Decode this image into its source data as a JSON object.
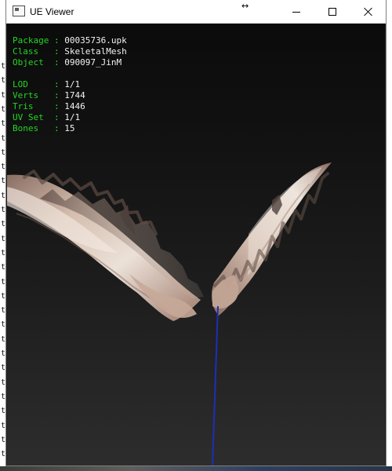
{
  "window": {
    "title": "UE Viewer",
    "buttons": {
      "minimize": "minimize",
      "maximize": "maximize",
      "close": "close"
    }
  },
  "viewer": {
    "info": [
      {
        "label": "Package",
        "separator": ":",
        "value": "00035736.upk"
      },
      {
        "label": "Class  ",
        "separator": ":",
        "value": "SkeletalMesh"
      },
      {
        "label": "Object ",
        "separator": ":",
        "value": "090097_JinM"
      },
      {
        "label": "",
        "separator": "",
        "value": ""
      },
      {
        "label": "LOD    ",
        "separator": ":",
        "value": "1/1"
      },
      {
        "label": "Verts  ",
        "separator": ":",
        "value": "1744"
      },
      {
        "label": "Tris   ",
        "separator": ":",
        "value": "1446"
      },
      {
        "label": "UV Set ",
        "separator": ":",
        "value": "1/1"
      },
      {
        "label": "Bones  ",
        "separator": ":",
        "value": "15"
      }
    ]
  },
  "background_console": {
    "line_char": "t",
    "rows": 28
  },
  "icons": {
    "app": "app-window-icon",
    "resize": "horizontal-resize-icon",
    "minimize": "minimize-icon",
    "maximize": "maximize-icon",
    "close": "close-icon"
  },
  "colors": {
    "titlebar": "#ffffff",
    "viewport_top": "#0b0b0b",
    "viewport_bottom": "#2d2d2d",
    "info_label": "#23d623",
    "info_value": "#f2f2f2",
    "wing_light": "#e6d4c8",
    "wing_mid": "#bfa394",
    "wing_dark": "#5e4c45",
    "bone_axis": "#1d2fb8"
  }
}
